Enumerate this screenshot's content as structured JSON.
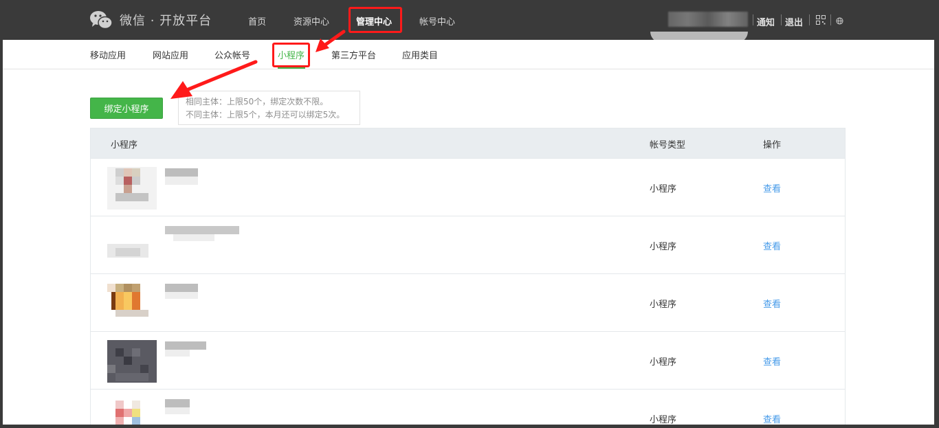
{
  "brand": {
    "name": "微信 · 开放平台",
    "logo_icon": "wechat-logo-icon"
  },
  "top_nav": [
    {
      "label": "首页",
      "active": false
    },
    {
      "label": "资源中心",
      "active": false
    },
    {
      "label": "管理中心",
      "active": true
    },
    {
      "label": "帐号中心",
      "active": false
    }
  ],
  "utility": {
    "notify": "通知",
    "logout": "退出",
    "qrcode_icon": "qrcode-icon",
    "globe_icon": "globe-icon"
  },
  "sub_nav": [
    {
      "label": "移动应用",
      "active": false
    },
    {
      "label": "网站应用",
      "active": false
    },
    {
      "label": "公众帐号",
      "active": false
    },
    {
      "label": "小程序",
      "active": true
    },
    {
      "label": "第三方平台",
      "active": false
    },
    {
      "label": "应用类目",
      "active": false
    }
  ],
  "bind_button": {
    "label": "绑定小程序"
  },
  "bind_tip": {
    "line1": "相同主体：上限50个，绑定次数不限。",
    "line2": "不同主体：上限5个，本月还可以绑定5次。"
  },
  "table": {
    "headers": {
      "app": "小程序",
      "type": "帐号类型",
      "action": "操作"
    },
    "rows": [
      {
        "type": "小程序",
        "action": "查看"
      },
      {
        "type": "小程序",
        "action": "查看"
      },
      {
        "type": "小程序",
        "action": "查看"
      },
      {
        "type": "小程序",
        "action": "查看"
      },
      {
        "type": "小程序",
        "action": "查看"
      }
    ]
  },
  "colors": {
    "accent": "#44b549",
    "link": "#459ae9",
    "annotation": "#ff1a1a",
    "topbar": "#3a3a3a"
  }
}
